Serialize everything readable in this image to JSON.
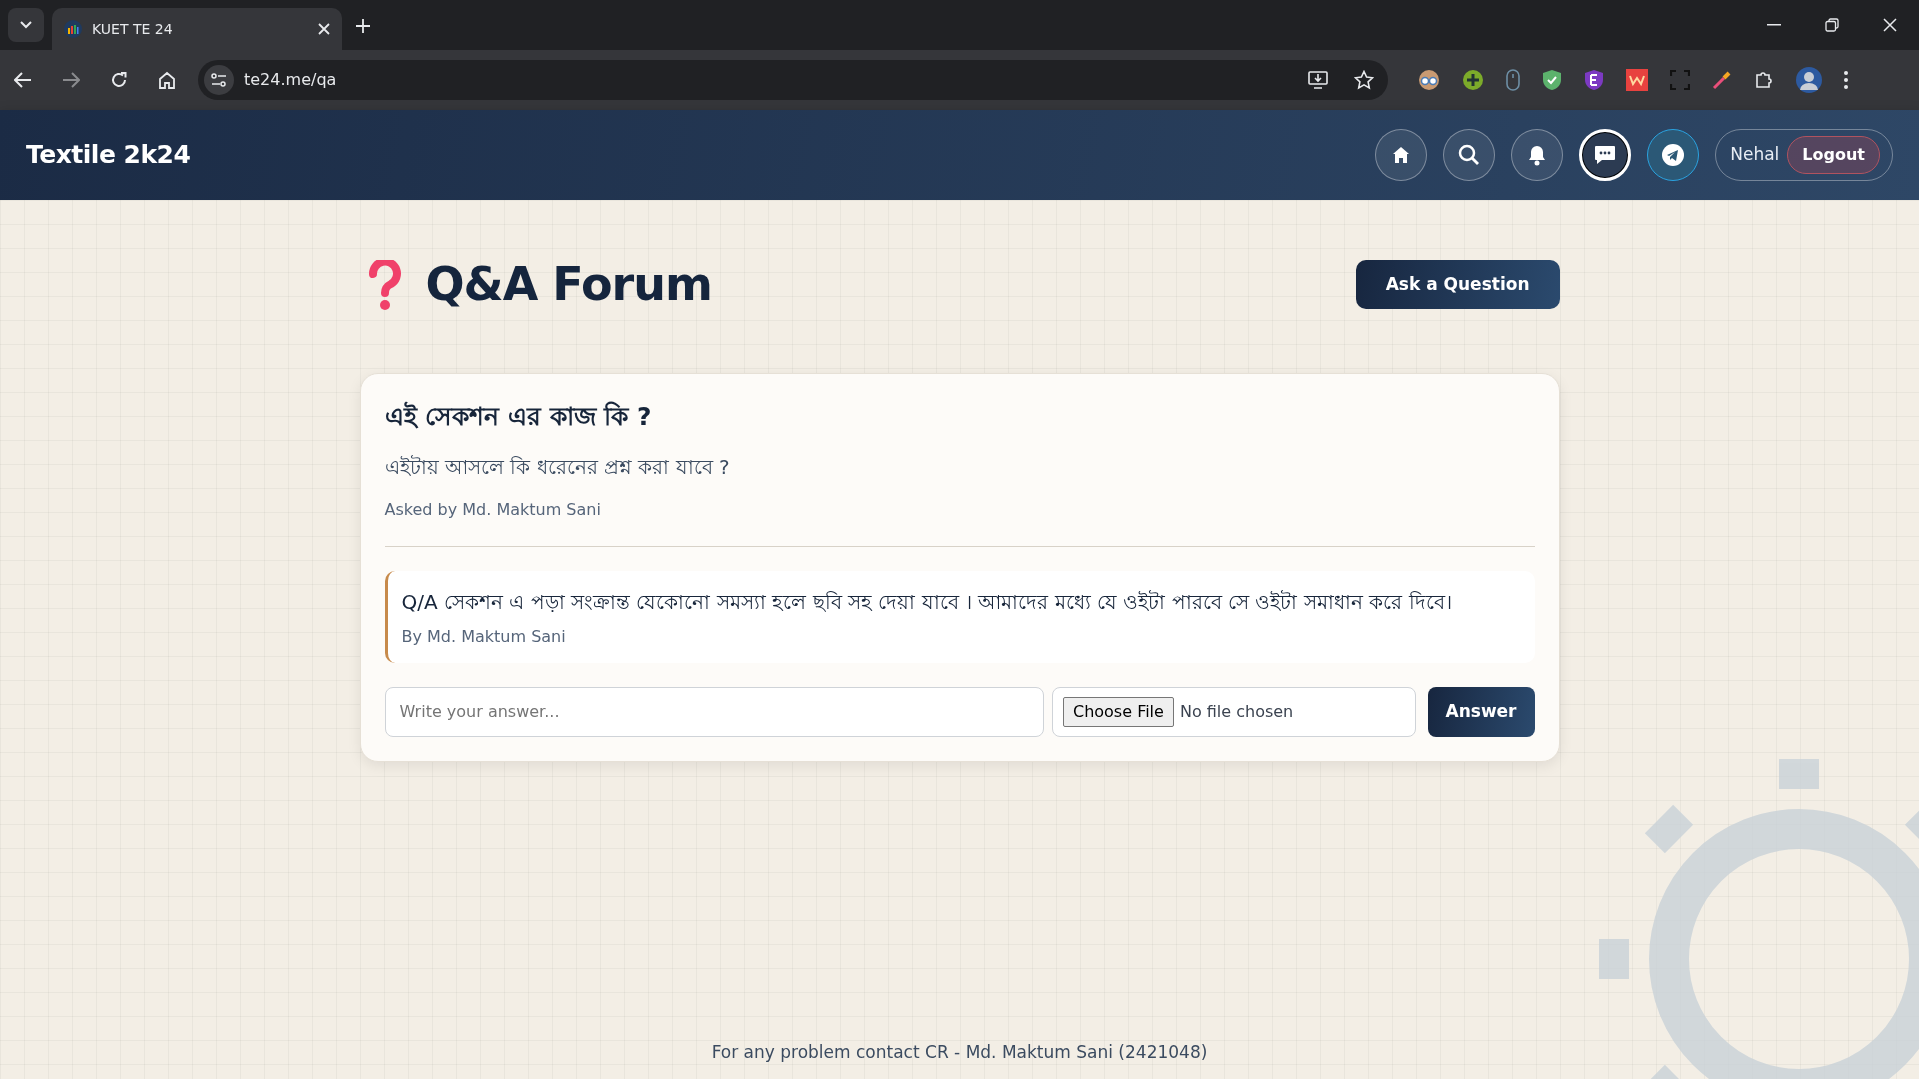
{
  "browser": {
    "tab_title": "KUET TE 24",
    "url": "te24.me/qa"
  },
  "navbar": {
    "brand": "Textile 2k24",
    "icons": [
      {
        "kind": "home",
        "selected": false
      },
      {
        "kind": "search",
        "selected": false
      },
      {
        "kind": "bell",
        "selected": false
      },
      {
        "kind": "chat",
        "selected": true
      },
      {
        "kind": "telegram",
        "selected": false
      }
    ],
    "user": "Nehal",
    "logout": "Logout"
  },
  "page": {
    "title": "Q&A Forum",
    "ask_button": "Ask a Question"
  },
  "questions": [
    {
      "title": "এই সেকশন এর কাজ কি ?",
      "body": "এইটায় আসলে কি ধরেনের প্রশ্ন করা যাবে ?",
      "asked_by": "Asked by Md. Maktum Sani",
      "answers": [
        {
          "text": "Q/A সেকশন এ পড়া সংক্রান্ত যেকোনো সমস্যা হলে ছবি সহ দেয়া যাবে । আমাদের মধ্যে যে ওইটা পারবে সে ওইটা সমাধান করে দিবে।",
          "by": "By Md. Maktum Sani"
        }
      ],
      "answer_field": {
        "placeholder": "Write your answer..."
      },
      "file_button": "Choose File",
      "file_status": "No file chosen",
      "submit": "Answer"
    }
  ],
  "footer": "For any problem contact CR - Md. Maktum Sani (2421048)"
}
